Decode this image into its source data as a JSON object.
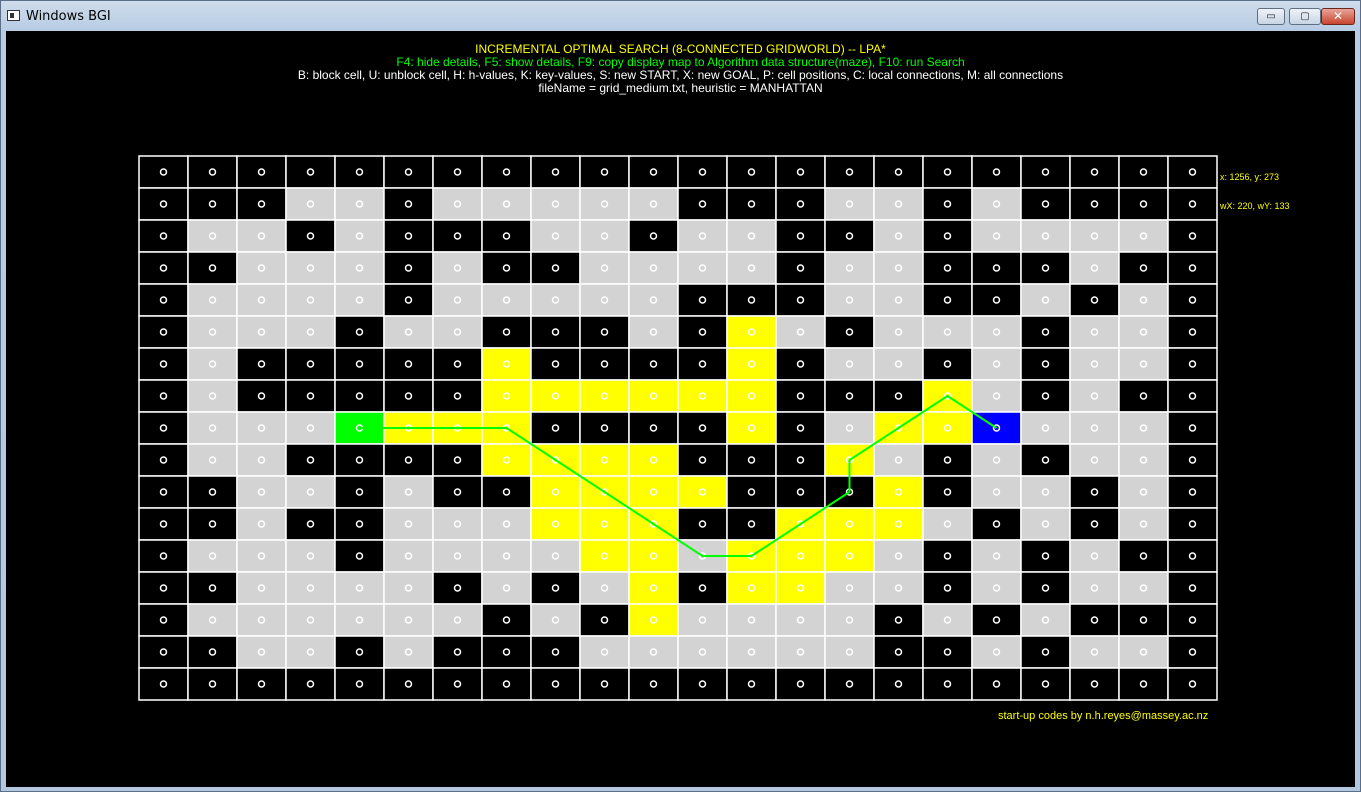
{
  "window": {
    "title": "Windows BGI",
    "buttons": {
      "minimize": "▭",
      "maximize": "▢",
      "close": "✕"
    }
  },
  "header": {
    "line1": "INCREMENTAL OPTIMAL SEARCH (8-CONNECTED GRIDWORLD) -- LPA*",
    "line2": "F4: hide details, F5: show details, F9: copy display map to Algorithm data structure(maze), F10: run Search",
    "line3": "B: block cell, U: unblock cell, H: h-values, K: key-values, S: new START, X: new GOAL, P: cell positions, C: local connections, M: all connections",
    "line4": "fileName = grid_medium.txt, heuristic = MANHATTAN"
  },
  "side_info": {
    "mouse": "x: 1256, y: 273",
    "world": "wX: 220, wY: 133"
  },
  "footer": {
    "credit": "start-up codes by n.h.reyes@massey.ac.nz"
  },
  "colors": {
    "background": "#000000",
    "blocked": "#000000",
    "free": "#d3d3d3",
    "expanded": "#ffff00",
    "start": "#00ff00",
    "goal": "#0000ff",
    "gridline": "#ffffff",
    "path": "#00ff00",
    "title": "#ffff00",
    "keys_line": "#00ff00",
    "text": "#ffffff"
  },
  "grid": {
    "cols": 22,
    "rows": 17,
    "legend": "B=blocked, .=free, Y=expanded, S=start, G=goal",
    "cells": [
      "BBBBBBBBBBBBBBBBBBBBBB",
      "BBB..B.....BBB..B.BBBB",
      "B..B.BBB..B..BB.B....B",
      "BB...B.BB....B..BBB.B",
      "B....B.....BBB..BB.B.B",
      "B...B..BBB.BY.B...B..B",
      "B.BBBBBYBBBBYB..B.B..B",
      "B.BBBBBYYYYYYBBBY.B.BB",
      "B...SYYYBBBBYB.YYG...B",
      "B..BBBBYYYYBBBY.B.B..B",
      "BB..B.BBYYYYBBBYB..B.B",
      "BB.BB...YYYBBYYY.B.B.B",
      "B...B....YY.YYY.B.B.BB",
      "BB....B.B.YBYY..B.B..B",
      "B......B.BY....B.B.BBB",
      "BB..B.BBB......BB.B..B",
      "BBBBBBBBBBBBBBBBBBBBBB"
    ]
  },
  "path": {
    "cells": [
      [
        4,
        8
      ],
      [
        7,
        8
      ],
      [
        11,
        12
      ],
      [
        12,
        12
      ],
      [
        14,
        10
      ],
      [
        14,
        9
      ],
      [
        16,
        7
      ],
      [
        17,
        8
      ]
    ]
  }
}
